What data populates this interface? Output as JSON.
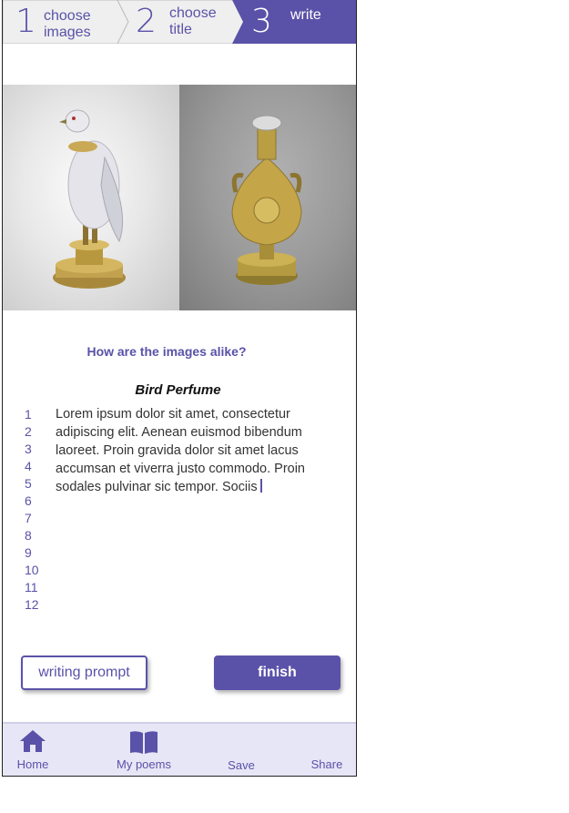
{
  "stepper": {
    "steps": [
      {
        "number": "1",
        "label_line1": "choose",
        "label_line2": "images",
        "state": "done"
      },
      {
        "number": "2",
        "label_line1": "choose",
        "label_line2": "title",
        "state": "done"
      },
      {
        "number": "3",
        "label_line1": "write",
        "label_line2": "",
        "state": "active"
      }
    ]
  },
  "images": {
    "left": {
      "icon": "bird-figurine-image"
    },
    "right": {
      "icon": "perfume-flask-image"
    }
  },
  "prompt_question": "How are the images alike?",
  "poem": {
    "title": "Bird Perfume",
    "text": "Lorem ipsum dolor sit amet, consectetur adipiscing elit. Aenean euismod bibendum laoreet. Proin gravida dolor sit amet lacus accumsan et viverra justo commodo. Proin sodales pulvinar sic tempor. Sociis",
    "line_numbers": [
      "1",
      "2",
      "3",
      "4",
      "5",
      "6",
      "7",
      "8",
      "9",
      "10",
      "11",
      "12"
    ]
  },
  "buttons": {
    "writing_prompt": "writing prompt",
    "finish": "finish"
  },
  "nav": {
    "home": "Home",
    "my_poems": "My poems",
    "save": "Save",
    "share": "Share"
  },
  "colors": {
    "accent": "#5a52a8",
    "nav_bg": "#e6e6f6",
    "step_inactive_bg": "#efefef"
  }
}
